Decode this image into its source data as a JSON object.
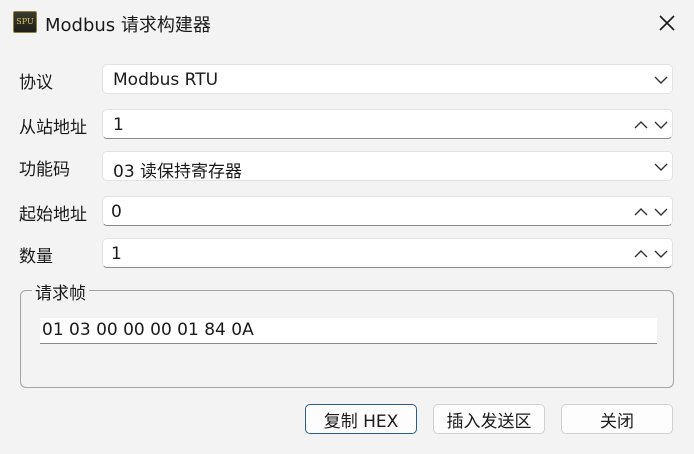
{
  "window": {
    "title": "Modbus 请求构建器",
    "icon_text": "SPU"
  },
  "form": {
    "protocol": {
      "label": "协议",
      "value": "Modbus RTU"
    },
    "slave_address": {
      "label": "从站地址",
      "value": "1"
    },
    "function_code": {
      "label": "功能码",
      "value": "03  读保持寄存器"
    },
    "start_address": {
      "label": "起始地址",
      "value": "0"
    },
    "quantity": {
      "label": "数量",
      "value": "1"
    }
  },
  "request_frame": {
    "title": "请求帧",
    "value": "01 03 00 00 00 01 84 0A"
  },
  "buttons": {
    "copy_hex": "复制 HEX",
    "insert_send": "插入发送区",
    "close": "关闭"
  },
  "icons": [
    "close-icon",
    "chevron-down-icon",
    "chevron-up-icon"
  ],
  "colors": {
    "primary_border": "#2a5f8c",
    "background": "#f3f3f3"
  }
}
